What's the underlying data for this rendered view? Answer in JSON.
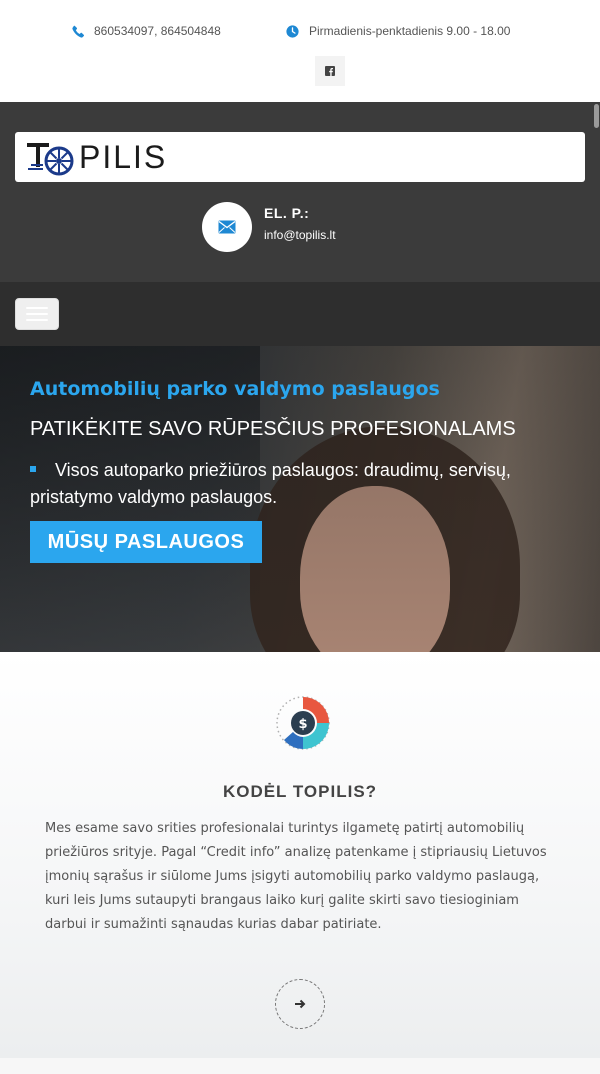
{
  "topbar": {
    "phone": "860534097, 864504848",
    "hours": "Pirmadienis-penktadienis 9.00 - 18.00",
    "facebook_icon": "facebook-icon"
  },
  "header": {
    "logo_text": "TOPILIS",
    "email_label": "EL. P.:",
    "email_value": "info@topilis.lt"
  },
  "hero": {
    "title": "Automobilių parko valdymo paslaugos",
    "subtitle": "PATIKĖKITE SAVO RŪPESČIUS PROFESIONALAMS",
    "bullet_text": "Visos autoparko priežiūros paslaugos: draudimų, servisų, pristatymo valdymo paslaugos.",
    "button_label": "MŪSŲ PASLAUGOS"
  },
  "why": {
    "title": "KODĖL TOPILIS?",
    "text": "Mes esame savo srities profesionalai turintys ilgametę patirtį automobilių priežiūros srityje. Pagal “Credit info” analizę patenkame į stipriausių Lietuvos įmonių sąrašus ir siūlome Jums įsigyti automobilių parko valdymo paslaugą, kuri leis Jums sutaupyti brangaus laiko kurį galite skirti savo tiesioginiam darbui ir sumažinti sąnaudas kurias dabar patiriate."
  },
  "colors": {
    "accent": "#2ba6ee",
    "header_bg": "#3b3b3b",
    "nav_bg": "#2e2e2e"
  }
}
